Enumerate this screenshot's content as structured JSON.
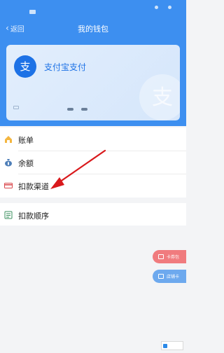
{
  "status_bar": {
    "indicators": [
      "dot",
      "dot",
      "rect"
    ]
  },
  "nav": {
    "back_label": "返回",
    "title": "我的钱包"
  },
  "card": {
    "name": "支付宝支付",
    "logo_glyph": "支",
    "watermark_glyph": "支",
    "brand_color": "#1d72e6"
  },
  "menu": {
    "items": [
      {
        "label": "账单",
        "icon": "bill-icon"
      },
      {
        "label": "余额",
        "icon": "money-bag-icon"
      },
      {
        "label": "扣款渠道",
        "icon": "card-icon"
      }
    ],
    "order_item": {
      "label": "扣款顺序",
      "icon": "list-icon"
    }
  },
  "floating_buttons": [
    {
      "label": "卡券包",
      "color": "#f07b7e",
      "icon": "ticket-icon"
    },
    {
      "label": "店铺卡",
      "color": "#6da9ee",
      "icon": "store-card-icon"
    }
  ],
  "annotation": {
    "color": "#d9191c",
    "target": "扣款渠道"
  },
  "colors": {
    "header": "#3d8ff0",
    "page_bg": "#f3f4f6",
    "text": "#222222"
  }
}
